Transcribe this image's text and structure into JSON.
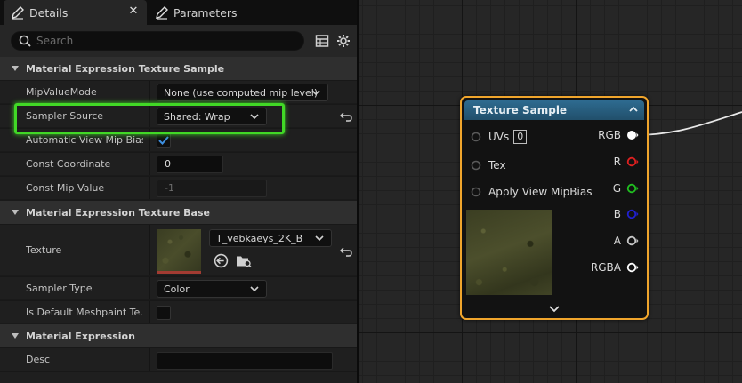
{
  "tabs": {
    "details_label": "Details",
    "parameters_label": "Parameters"
  },
  "search": {
    "placeholder": "Search"
  },
  "sections": {
    "texture_sample": "Material Expression Texture Sample",
    "texture_base": "Material Expression Texture Base",
    "expression": "Material Expression"
  },
  "properties": {
    "mip_value_mode": {
      "label": "MipValueMode",
      "value": "None (use computed mip level)"
    },
    "sampler_source": {
      "label": "Sampler Source",
      "value": "Shared: Wrap"
    },
    "auto_view_mip_bias": {
      "label": "Automatic View Mip Bias",
      "checked": true
    },
    "const_coordinate": {
      "label": "Const Coordinate",
      "value": "0"
    },
    "const_mip_value": {
      "label": "Const Mip Value",
      "value": "-1"
    },
    "texture": {
      "label": "Texture",
      "value": "T_vebkaeys_2K_B"
    },
    "sampler_type": {
      "label": "Sampler Type",
      "value": "Color"
    },
    "is_default_meshpaint": {
      "label": "Is Default Meshpaint Te...",
      "checked": false
    },
    "desc": {
      "label": "Desc",
      "value": ""
    }
  },
  "node": {
    "title": "Texture Sample",
    "inputs": {
      "uvs": "UVs",
      "uvs_value": "0",
      "tex": "Tex",
      "apply_view_mip_bias": "Apply View MipBias"
    },
    "outputs": {
      "rgb": "RGB",
      "r": "R",
      "g": "G",
      "b": "B",
      "a": "A",
      "rgba": "RGBA"
    }
  },
  "colors": {
    "highlight": "#41d826",
    "node_border": "#f0a52c",
    "pin_r": "#e02020",
    "pin_g": "#20c020",
    "pin_b": "#2020d0",
    "pin_white": "#ffffff",
    "pin_gray": "#c8c8c8"
  }
}
